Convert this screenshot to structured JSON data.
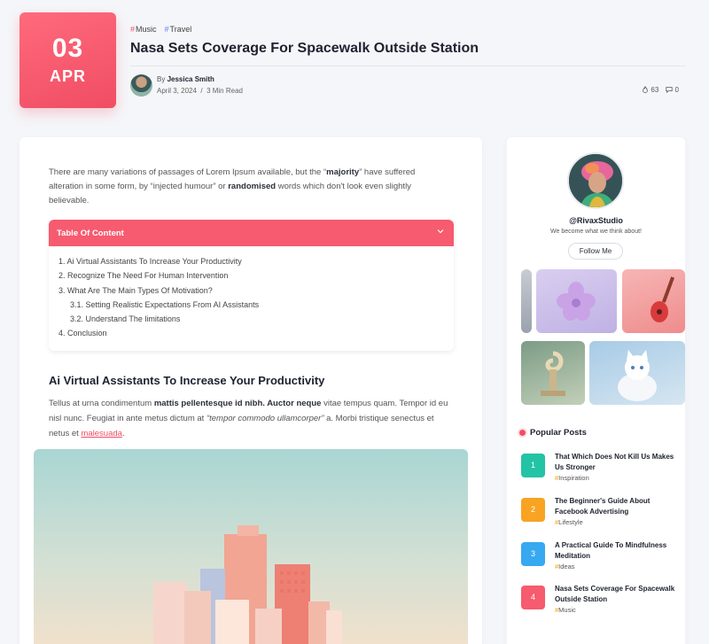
{
  "date": {
    "day": "03",
    "month": "APR"
  },
  "tags": [
    {
      "label": "Music",
      "color": "#f04d63"
    },
    {
      "label": "Travel",
      "color": "#5b7cff"
    }
  ],
  "post": {
    "title": "Nasa Sets Coverage For Spacewalk Outside Station",
    "by_prefix": "By",
    "author": "Jessica Smith",
    "date": "April 3, 2024",
    "separator": "/",
    "read_time": "3 Min Read",
    "views": "63",
    "comments": "0"
  },
  "intro": {
    "part1": "There are many variations of passages of Lorem Ipsum available, but the “",
    "bold1": "majority",
    "part2": "” have suffered alteration in some form, by “injected humour” or ",
    "bold2": "randomised",
    "part3": " words which don't look even slightly believable."
  },
  "toc": {
    "title": "Table Of Content",
    "items": [
      "1. Ai Virtual Assistants To Increase Your Productivity",
      "2. Recognize The Need For Human Intervention",
      "3. What Are The Main Types Of Motivation?",
      "3.1. Setting Realistic Expectations From AI Assistants",
      "3.2. Understand The limitations",
      "4. Conclusion"
    ]
  },
  "section": {
    "title": "Ai Virtual Assistants To Increase Your Productivity",
    "t1": "Tellus at urna condimentum ",
    "b1": "mattis pellentesque id nibh. Auctor neque",
    "t2": " vitae tempus quam. Tempor id eu nisl nunc. Feugiat in ante metus dictum at ",
    "i1": "“tempor commodo ullamcorper”",
    "t3": " a. Morbi tristique senectus et netus et ",
    "link": "malesuada",
    "t4": "."
  },
  "profile": {
    "handle": "@RivaxStudio",
    "tagline": "We become what we think about!",
    "follow": "Follow Me"
  },
  "popular": {
    "title": "Popular Posts",
    "items": [
      {
        "num": "1",
        "title": "That Which Does Not Kill Us Makes Us Stronger",
        "category": "Inspiration",
        "color": "#23c3a6"
      },
      {
        "num": "2",
        "title": "The Beginner's Guide About Facebook Advertising",
        "category": "Lifestyle",
        "color": "#f8a322"
      },
      {
        "num": "3",
        "title": "A Practical Guide To Mindfulness Meditation",
        "category": "Ideas",
        "color": "#37a9f0"
      },
      {
        "num": "4",
        "title": "Nasa Sets Coverage For Spacewalk Outside Station",
        "category": "Music",
        "color": "#f65b6f"
      }
    ]
  },
  "colors": {
    "accent": "#f04d63",
    "toc_header": "#f65b6f"
  }
}
